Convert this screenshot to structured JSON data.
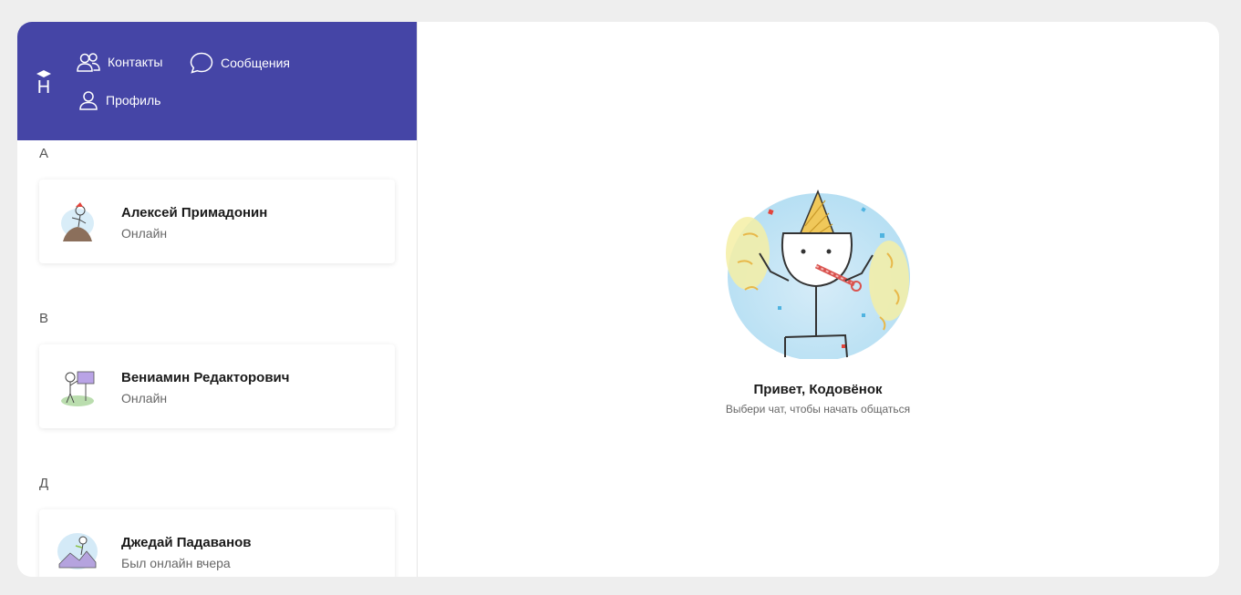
{
  "nav": {
    "logo_letter": "Н",
    "contacts_label": "Контакты",
    "messages_label": "Сообщения",
    "profile_label": "Профиль"
  },
  "contacts": {
    "groups": [
      {
        "letter": "А",
        "items": [
          {
            "name": "Алексей Примадонин",
            "status": "Онлайн"
          }
        ]
      },
      {
        "letter": "В",
        "items": [
          {
            "name": "Вениамин Редакторович",
            "status": "Онлайн"
          }
        ]
      },
      {
        "letter": "Д",
        "items": [
          {
            "name": "Джедай Падаванов",
            "status": "Был онлайн вчера"
          }
        ]
      }
    ]
  },
  "main": {
    "greeting": "Привет, Кодовёнок",
    "subtitle": "Выбери чат, чтобы начать общаться"
  },
  "colors": {
    "brand": "#4545a6",
    "background": "#eeeeee"
  }
}
